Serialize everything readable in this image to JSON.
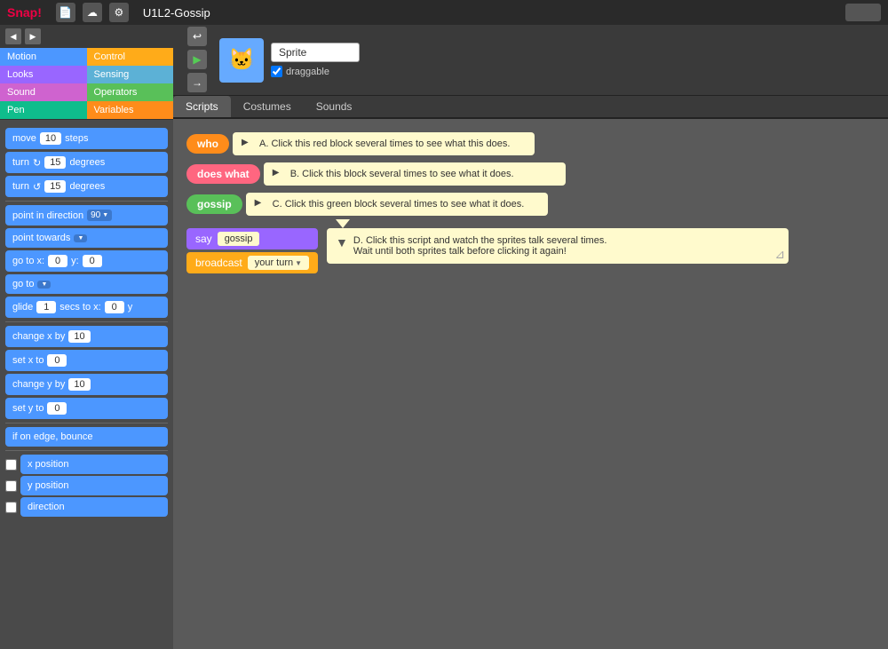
{
  "app": {
    "logo": "Snap!",
    "title": "U1L2-Gossip",
    "settings_icon": "⚙",
    "file_icon": "📄",
    "cloud_icon": "☁"
  },
  "categories": [
    {
      "label": "Motion",
      "class": "cat-motion"
    },
    {
      "label": "Control",
      "class": "cat-control"
    },
    {
      "label": "Looks",
      "class": "cat-looks"
    },
    {
      "label": "Sensing",
      "class": "cat-sensing"
    },
    {
      "label": "Sound",
      "class": "cat-sound"
    },
    {
      "label": "Operators",
      "class": "cat-operators"
    },
    {
      "label": "Pen",
      "class": "cat-pen"
    },
    {
      "label": "Variables",
      "class": "cat-variables"
    }
  ],
  "blocks": [
    {
      "type": "move",
      "label": "move",
      "num": "10",
      "suffix": "steps"
    },
    {
      "type": "turn_cw",
      "label": "turn",
      "num": "15",
      "suffix": "degrees",
      "dir": "↻"
    },
    {
      "type": "turn_ccw",
      "label": "turn",
      "num": "15",
      "suffix": "degrees",
      "dir": "↺"
    },
    {
      "type": "point_dir",
      "label": "point in direction",
      "val": "90"
    },
    {
      "type": "point_towards",
      "label": "point towards"
    },
    {
      "type": "go_to_xy",
      "label": "go to x:",
      "x": "0",
      "y": "0"
    },
    {
      "type": "go_to",
      "label": "go to"
    },
    {
      "type": "glide",
      "label": "glide",
      "secs": "1",
      "x": "0"
    },
    {
      "type": "change_x",
      "label": "change x by",
      "num": "10"
    },
    {
      "type": "set_x",
      "label": "set x to",
      "num": "0"
    },
    {
      "type": "change_y",
      "label": "change y by",
      "num": "10"
    },
    {
      "type": "set_y",
      "label": "set y to",
      "num": "0"
    },
    {
      "type": "bounce",
      "label": "if on edge, bounce"
    },
    {
      "type": "x_pos",
      "label": "x position"
    },
    {
      "type": "y_pos",
      "label": "y position"
    },
    {
      "type": "direction",
      "label": "direction"
    }
  ],
  "sprite": {
    "name": "Sprite",
    "draggable": true,
    "draggable_label": "draggable"
  },
  "tabs": [
    {
      "label": "Scripts",
      "active": true
    },
    {
      "label": "Costumes",
      "active": false
    },
    {
      "label": "Sounds",
      "active": false
    }
  ],
  "scripts": {
    "who_label": "who",
    "does_what_label": "does what",
    "gossip_label": "gossip",
    "instruction_a": "A. Click this red block several times to see what this does.",
    "instruction_b": "B.  Click this block several times to see what it does.",
    "instruction_c": "C.  Click this green block several times to see what it does.",
    "say_label": "say",
    "gossip_text": "gossip",
    "broadcast_label": "broadcast",
    "broadcast_val": "your turn",
    "instruction_d_title": "D.  Click this script and watch the sprites talk several times.",
    "instruction_d_body": "Wait until both sprites talk before clicking it again!"
  }
}
